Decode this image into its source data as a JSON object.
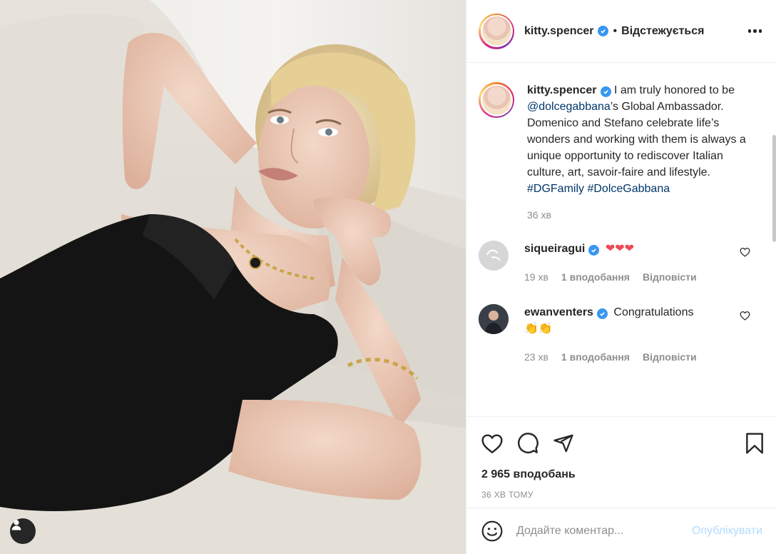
{
  "post": {
    "author": "kitty.spencer",
    "follow_status": "Відстежується",
    "separator": "•",
    "caption": {
      "author": "kitty.spencer",
      "text_before_mention": "I am truly honored to be ",
      "mention": "@dolcegabbana",
      "text_after_mention": "’s Global Ambassador. Domenico and Stefano celebrate life’s wonders and working with them is always a unique opportunity to rediscover Italian culture, art, savoir-faire and lifestyle. ",
      "hashtags": [
        "#DGFamily",
        "#DolceGabbana"
      ],
      "time": "36 хв"
    },
    "comments": [
      {
        "username": "siqueiragui",
        "text": "❤❤❤",
        "time": "19 хв",
        "likes": "1 вподобання",
        "reply_label": "Відповісти",
        "verified": true
      },
      {
        "username": "ewanventers",
        "text": "Congratulations",
        "emoji": "👏👏",
        "time": "23 хв",
        "likes": "1 вподобання",
        "reply_label": "Відповісти",
        "verified": true
      }
    ],
    "likes_count": "2 965 вподобань",
    "posted_ago": "36 хв тому",
    "comment_placeholder": "Додайте коментар...",
    "publish_label": "Опублікувати"
  },
  "icons": {
    "more": "more-options-icon",
    "like": "heart-icon",
    "comment": "comment-icon",
    "share": "share-icon",
    "save": "bookmark-icon",
    "emoji": "emoji-icon",
    "tag_user": "user-tag-icon",
    "verified": "verified-badge-icon"
  },
  "colors": {
    "verified": "#3897f0",
    "link": "#00376b",
    "muted": "#8e8e8e",
    "publish_disabled": "#b3dbff",
    "heart_red": "#ed4956"
  }
}
